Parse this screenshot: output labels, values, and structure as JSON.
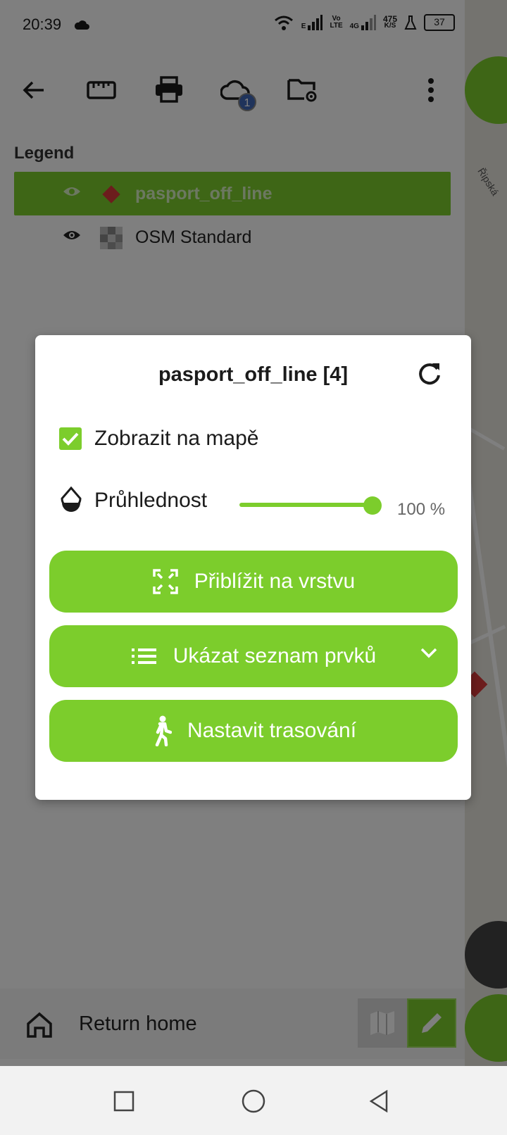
{
  "status_bar": {
    "time": "20:39",
    "net_type": "E",
    "volte_top": "Vo",
    "volte_bottom": "LTE",
    "net_4g": "4G",
    "speed_value": "475",
    "speed_unit": "K/S",
    "battery": "37",
    "icons": [
      "cloud-icon",
      "wifi-icon",
      "signal-icon",
      "flask-icon",
      "battery-icon"
    ]
  },
  "toolbar": {
    "buttons": [
      "back-arrow-icon",
      "ruler-icon",
      "print-icon",
      "cloud-sync-icon",
      "folder-settings-icon",
      "more-vert-icon"
    ],
    "sync_badge": "1"
  },
  "legend": {
    "title": "Legend",
    "layers": [
      {
        "label": "pasport_off_line",
        "selected": true,
        "symbol": "red-diamond"
      },
      {
        "label": "OSM Standard",
        "selected": false,
        "symbol": "checker-tile"
      }
    ]
  },
  "map": {
    "street_label": "Řipská"
  },
  "bottom_bar": {
    "home_label": "Return home"
  },
  "dialog": {
    "title": "pasport_off_line [4]",
    "show_on_map_label": "Zobrazit na mapě",
    "show_on_map_checked": true,
    "opacity_label": "Průhlednost",
    "opacity_value": "100 %",
    "opacity_level": 1.0,
    "zoom_button": "Přiblížit na vrstvu",
    "list_button": "Ukázat seznam prvků",
    "tracking_button": "Nastavit trasování"
  },
  "colors": {
    "accent_green": "#7ccd2c",
    "badge_blue": "#3f66b7",
    "feature_red": "#d93a3a"
  }
}
